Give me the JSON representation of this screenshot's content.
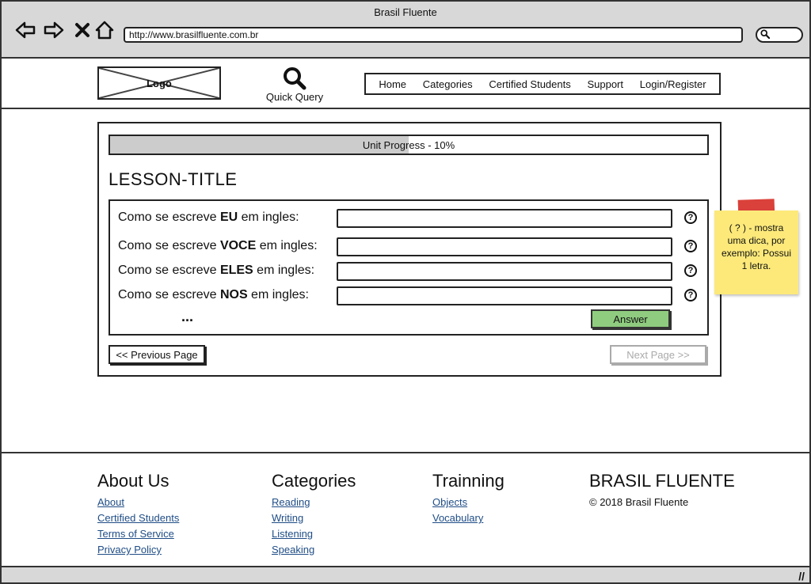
{
  "window": {
    "title": "Brasil Fluente"
  },
  "browser": {
    "url": "http://www.brasilfluente.com.br",
    "back_icon": "arrow-left-icon",
    "forward_icon": "arrow-right-icon",
    "close_icon": "close-icon",
    "home_icon": "home-icon"
  },
  "header": {
    "logo_text": "Logo",
    "quick_query_label": "Quick Query",
    "menu": [
      {
        "label": "Home"
      },
      {
        "label": "Categories"
      },
      {
        "label": "Certified Students"
      },
      {
        "label": "Support"
      },
      {
        "label": "Login/Register"
      }
    ]
  },
  "lesson": {
    "progress_label": "Unit Progress - 10%",
    "progress_value": 0.1,
    "title": "LESSON-TITLE",
    "questions": [
      {
        "prefix": "Como se escreve ",
        "keyword": "EU",
        "suffix": " em ingles:",
        "value": "",
        "help": "?"
      },
      {
        "prefix": "Como se escreve ",
        "keyword": "VOCE",
        "suffix": " em ingles:",
        "value": "",
        "help": "?"
      },
      {
        "prefix": "Como se escreve ",
        "keyword": "ELES",
        "suffix": " em ingles:",
        "value": "",
        "help": "?"
      },
      {
        "prefix": "Como se escreve ",
        "keyword": "NOS",
        "suffix": " em ingles:",
        "value": "",
        "help": "?"
      }
    ],
    "more": "...",
    "answer_label": "Answer",
    "prev_label": "<< Previous Page",
    "next_label": "Next Page >>"
  },
  "note": {
    "text": "( ? ) - mostra uma dica, por exemplo: Possui 1 letra."
  },
  "footer": {
    "about": {
      "heading": "About Us",
      "links": [
        "About",
        "Certified Students",
        "Terms of Service",
        "Privacy Policy"
      ]
    },
    "categories": {
      "heading": "Categories",
      "links": [
        "Reading",
        "Writing",
        "Listening",
        "Speaking"
      ]
    },
    "training": {
      "heading": "Trainning",
      "links": [
        "Objects",
        "Vocabulary"
      ]
    },
    "brand": {
      "heading": "BRASIL FLUENTE",
      "copyright": "© 2018 Brasil Fluente"
    }
  },
  "colors": {
    "answer_button": "#8fcc7f",
    "note_bg": "#fce97a",
    "note_tape": "#d8372f",
    "link": "#1f4d86"
  }
}
